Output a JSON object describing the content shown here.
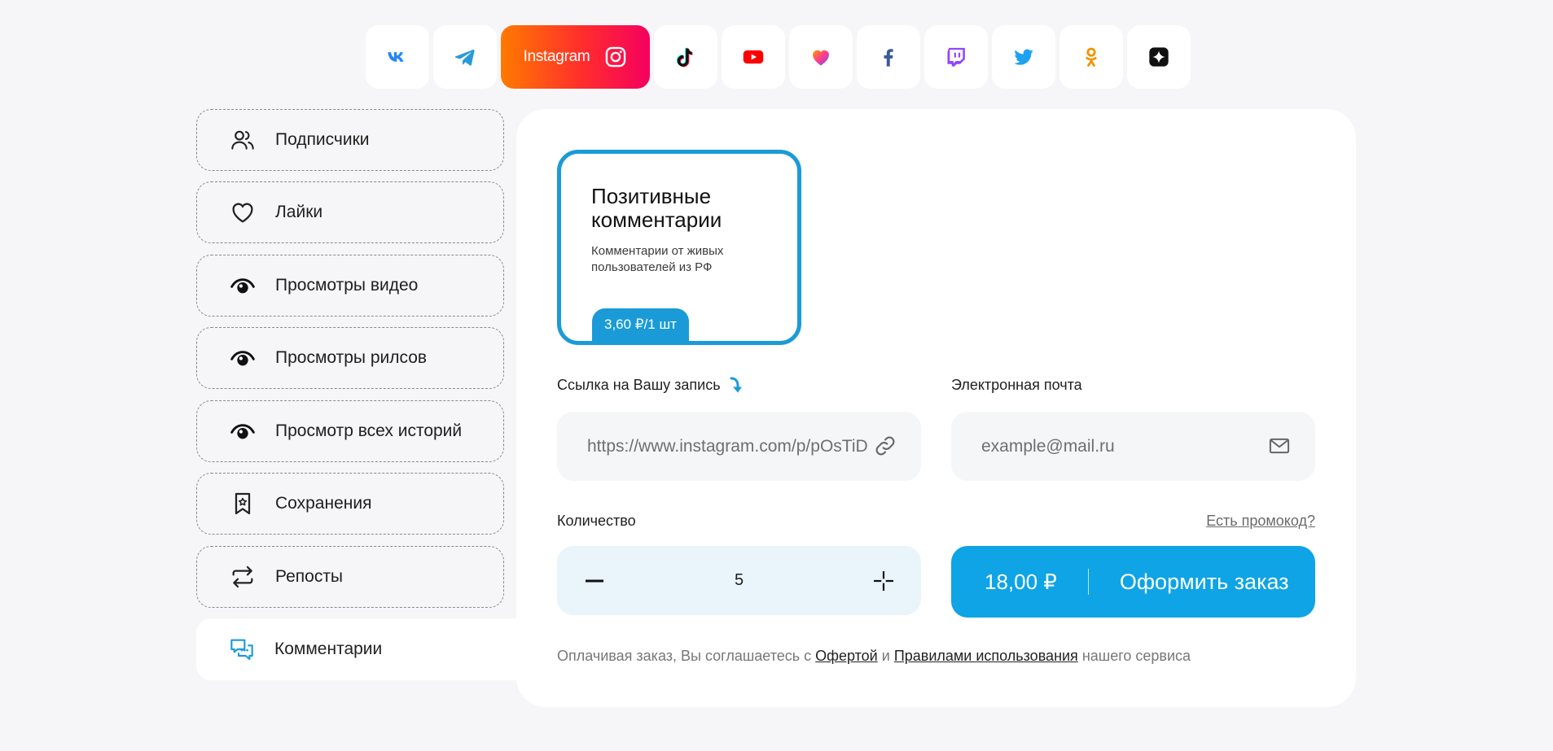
{
  "social": [
    {
      "name": "vk",
      "label": ""
    },
    {
      "name": "telegram",
      "label": ""
    },
    {
      "name": "instagram",
      "label": "Instagram",
      "active": true
    },
    {
      "name": "tiktok",
      "label": ""
    },
    {
      "name": "youtube",
      "label": ""
    },
    {
      "name": "likee",
      "label": ""
    },
    {
      "name": "facebook",
      "label": ""
    },
    {
      "name": "twitch",
      "label": ""
    },
    {
      "name": "twitter",
      "label": ""
    },
    {
      "name": "odnoklassniki",
      "label": ""
    },
    {
      "name": "other",
      "label": ""
    }
  ],
  "menu": {
    "items": [
      {
        "label": "Подписчики",
        "icon": "users-icon"
      },
      {
        "label": "Лайки",
        "icon": "heart-icon"
      },
      {
        "label": "Просмотры видео",
        "icon": "eye-icon"
      },
      {
        "label": "Просмотры рилсов",
        "icon": "eye-icon"
      },
      {
        "label": "Просмотр всех историй",
        "icon": "eye-icon"
      },
      {
        "label": "Сохранения",
        "icon": "bookmark-icon"
      },
      {
        "label": "Репосты",
        "icon": "repost-icon"
      },
      {
        "label": "Комментарии",
        "icon": "comments-icon",
        "active": true
      }
    ]
  },
  "service": {
    "title": "Позитивные комментарии",
    "description": "Комментарии от живых пользователей из РФ",
    "price": "3,60 ₽/1 шт"
  },
  "form": {
    "link_label": "Ссылка на Вашу запись",
    "link_value": "https://www.instagram.com/p/pOsTiD",
    "email_label": "Электронная почта",
    "email_placeholder": "example@mail.ru",
    "quantity_label": "Количество",
    "promo_label": "Есть промокод?",
    "quantity": "5",
    "total": "18,00 ₽",
    "order_label": "Оформить заказ"
  },
  "legal": {
    "prefix": "Оплачивая заказ, Вы соглашаетесь с",
    "offer": "Офертой",
    "and": "и",
    "rules": "Правилами использования",
    "suffix": "нашего сервиса"
  },
  "colors": {
    "accent": "#0ea4e5",
    "card_border": "#1a9bd7",
    "background": "#f6f6f8"
  }
}
